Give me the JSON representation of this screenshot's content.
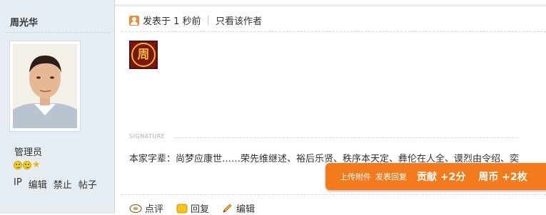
{
  "author": {
    "name": "周光华",
    "group": "管理员",
    "admin_links": [
      "IP",
      "编辑",
      "禁止",
      "帖子"
    ]
  },
  "post": {
    "posted_label": "发表于 1 秒前",
    "separator": "|",
    "only_author": "只看该作者",
    "seal_char": "周",
    "signature_label": "SIGNATURE",
    "signature_text": "本家字辈：尚梦应康世……荣先维继述、裕后乐贤、秩序本天定、彝伦在人全、谟烈由令绍、奕"
  },
  "reward": {
    "actions": [
      "上传附件",
      "发表回复"
    ],
    "values": [
      "贡献 +2分",
      "周币 +2枚"
    ]
  },
  "actions": [
    "点评",
    "回复",
    "编辑"
  ],
  "colors": {
    "sidebar_bg": "#e5edf2",
    "reward_bg": "#f37b1d",
    "seal_bg": "#7a1810",
    "seal_gold": "#f1b33c"
  },
  "icons": [
    "poster-icon",
    "smile-icon",
    "star-icon",
    "comment-icon",
    "reply-icon",
    "edit-pencil-icon"
  ]
}
